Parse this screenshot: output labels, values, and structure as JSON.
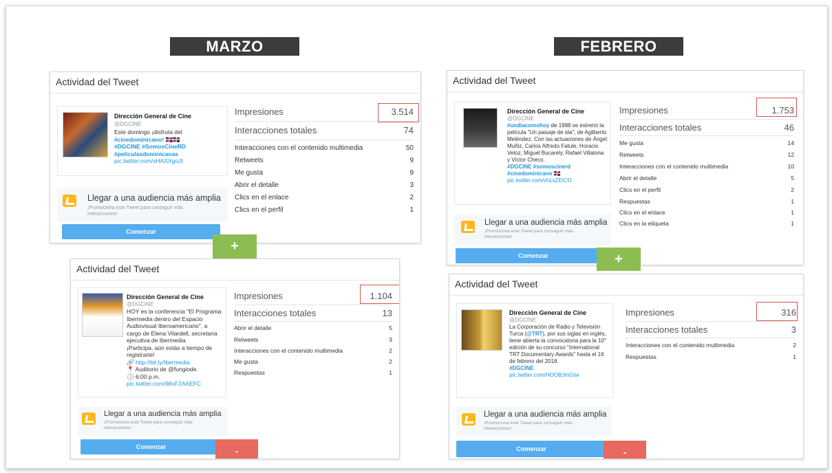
{
  "headings": {
    "marzo": "MARZO",
    "febrero": "FEBRERO"
  },
  "colors": {
    "heading_bg": "#3c3c3c",
    "link": "#1b95e0",
    "button": "#55acee",
    "green_tab": "#8dbd52",
    "red_tab": "#e8695d",
    "highlight": "#d9534f"
  },
  "cards": [
    {
      "title": "Actividad del Tweet",
      "tweet": {
        "author": "Dirección General de Cine",
        "handle": "@DGCINE",
        "text1": "Este domingo ¡disfruta del",
        "link1": "#cinedominicano! 🇩🇴🇩🇴",
        "link2": "#DGCINE #SomosCineRD",
        "link3": "#peliculasdominicanas",
        "url": "pic.twitter.com/xHASXgoJI"
      },
      "impressions_label": "Impresiones",
      "impressions_value": "3.514",
      "total_label": "Interacciones totales",
      "total_value": "74",
      "rows": [
        {
          "label": "Interacciones con el contenido multimedia",
          "value": "50"
        },
        {
          "label": "Retweets",
          "value": "9"
        },
        {
          "label": "Me gusta",
          "value": "9"
        },
        {
          "label": "Abrir el detalle",
          "value": "3"
        },
        {
          "label": "Clics en el enlace",
          "value": "2"
        },
        {
          "label": "Clics en el perfil",
          "value": "1"
        }
      ],
      "promo_title": "Llegar a una audiencia más amplia",
      "promo_sub": "¡Promociona este Tweet para conseguir más interacciones!",
      "button": "Comenzar"
    },
    {
      "title": "Actividad del Tweet",
      "tweet": {
        "author": "Dirección General de Cine",
        "handle": "@DGCINE",
        "text1": "HOY es la conferencia \"El Programa Ibermedia dentro del Espacio Audiovisual Iberoamericano\", a cargo de Elena Vilardell, secretaria ejecutiva de Ibermedia.",
        "text2": "¡Participa, aún estás a tiempo de registrarte!",
        "url1": "http://bit.ly/Ibermedia",
        "loc": "Auditorio de @fungiode.",
        "time": "6:00 p.m.",
        "url": "pic.twitter.com/98xF2AAEFC"
      },
      "impressions_label": "Impresiones",
      "impressions_value": "1.104",
      "total_label": "Interacciones totales",
      "total_value": "13",
      "rows": [
        {
          "label": "Abrir el detalle",
          "value": "5"
        },
        {
          "label": "Retweets",
          "value": "3"
        },
        {
          "label": "Interacciones con el contenido multimedia",
          "value": "2"
        },
        {
          "label": "Me gusta",
          "value": "2"
        },
        {
          "label": "Respuestas",
          "value": "1"
        }
      ],
      "promo_title": "Llegar a una audiencia más amplia",
      "promo_sub": "¡Promociona este Tweet para conseguir más interacciones!",
      "button": "Comenzar"
    },
    {
      "title": "Actividad del Tweet",
      "tweet": {
        "author": "Dirección General de Cine",
        "handle": "@DGCINE",
        "link1": "#undiacomohoy",
        "text1": "de 1988 se estrenó la película \"Un paisaje de ida\", de Agliberto Meléndez. Con las actuaciones de Ángel Muñiz, Carlos Alfredo Fatule, Horacio Veloz, Miguel Bucarely, Rafael Villalona y Víctor Checo.",
        "link2": "#DGCINE #somoscinerd #cinedominicano 🇩🇴",
        "url": "pic.twitter.com/vhLsZEiCfJ"
      },
      "impressions_label": "Impresiones",
      "impressions_value": "1.753",
      "total_label": "Interacciones totales",
      "total_value": "46",
      "rows": [
        {
          "label": "Me gusta",
          "value": "14"
        },
        {
          "label": "Retweets",
          "value": "12"
        },
        {
          "label": "Interacciones con el contenido multimedia",
          "value": "10"
        },
        {
          "label": "Abrir el detalle",
          "value": "5"
        },
        {
          "label": "Clics en el perfil",
          "value": "2"
        },
        {
          "label": "Respuestas",
          "value": "1"
        },
        {
          "label": "Clics en el enlace",
          "value": "1"
        },
        {
          "label": "Clics en la etiqueta",
          "value": "1"
        }
      ],
      "promo_title": "Llegar a una audiencia más amplia",
      "promo_sub": "¡Promociona este Tweet para conseguir más interacciones!",
      "button": "Comenzar"
    },
    {
      "title": "Actividad del Tweet",
      "tweet": {
        "author": "Dirección General de Cine",
        "handle": "@DGCINE",
        "text1": "La Corporación de Radio y Televisión Turca (",
        "mention": "@TRT",
        "text2": "), por sus siglas en inglés, tiene abierta la convocatoria para la 10° edición de su concurso \"International TRT Documentary Awards\" hasta el 16 de febrero del 2018.",
        "link1": "#DGCINE",
        "url": "pic.twitter.com/HOOBJmGtw"
      },
      "impressions_label": "Impresiones",
      "impressions_value": "316",
      "total_label": "Interacciones totales",
      "total_value": "3",
      "rows": [
        {
          "label": "Interacciones con el contenido multimedia",
          "value": "2"
        },
        {
          "label": "Respuestas",
          "value": "1"
        }
      ],
      "promo_title": "Llegar a una audiencia más amplia",
      "promo_sub": "¡Promociona este Tweet para conseguir más interacciones!",
      "button": "Comenzar"
    }
  ],
  "plus": "+",
  "minus": "-"
}
